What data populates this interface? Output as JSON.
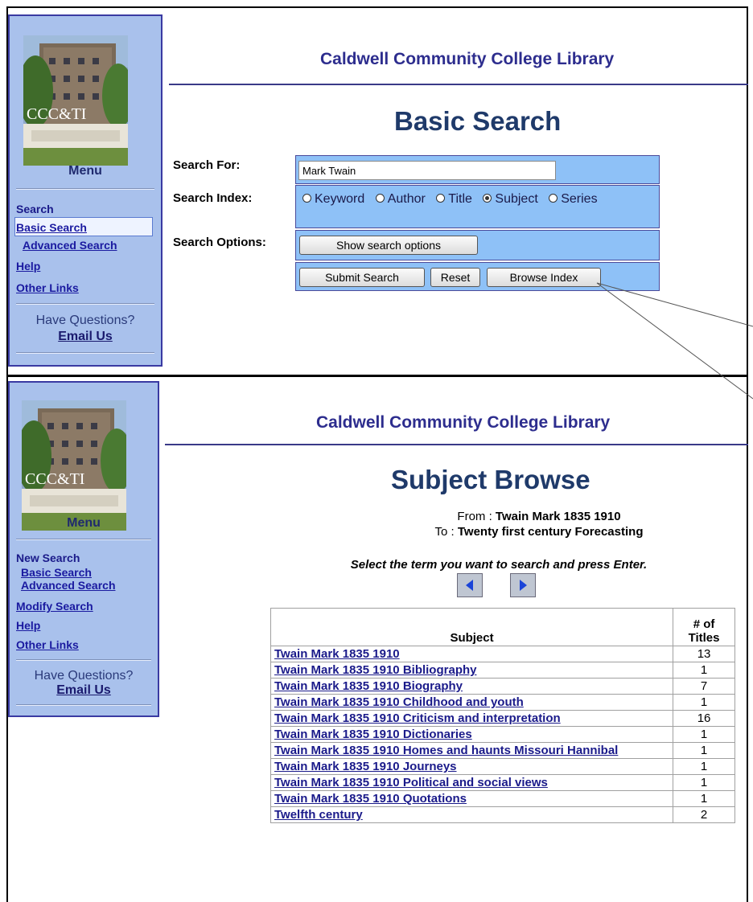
{
  "site_title": "Caldwell Community College Library",
  "sidebar_top": {
    "logo_text": "CCC&TI",
    "menu": "Menu",
    "section": "Search",
    "items": [
      "Basic Search",
      "Advanced Search"
    ],
    "help": "Help",
    "other_links": "Other Links",
    "questions": "Have Questions?",
    "email": "Email Us"
  },
  "basic_search": {
    "title": "Basic Search",
    "search_for_label": "Search For:",
    "search_for_value": "Mark Twain",
    "search_index_label": "Search Index:",
    "index_options": [
      "Keyword",
      "Author",
      "Title",
      "Subject",
      "Series"
    ],
    "selected_index": "Subject",
    "search_options_label": "Search Options:",
    "show_options_button": "Show search options",
    "submit_button": "Submit Search",
    "reset_button": "Reset",
    "browse_button": "Browse Index"
  },
  "sidebar_bottom": {
    "logo_text": "CCC&TI",
    "menu": "Menu",
    "section": "New Search",
    "items": [
      "Basic Search",
      "Advanced Search"
    ],
    "modify": "Modify Search",
    "help": "Help",
    "other_links": "Other Links",
    "questions": "Have Questions?",
    "email": "Email Us"
  },
  "subject_browse": {
    "title": "Subject Browse",
    "from_label": "From :",
    "from_value": "Twain Mark 1835 1910",
    "to_label": "To :",
    "to_value": "Twenty first century Forecasting",
    "instruction": "Select the term you want to search and press Enter.",
    "col_subject": "Subject",
    "col_titles": "# of Titles",
    "rows": [
      {
        "subject": "Twain Mark 1835 1910",
        "count": "13"
      },
      {
        "subject": "Twain Mark 1835 1910 Bibliography",
        "count": "1"
      },
      {
        "subject": "Twain Mark 1835 1910 Biography",
        "count": "7"
      },
      {
        "subject": "Twain Mark 1835 1910 Childhood and youth",
        "count": "1"
      },
      {
        "subject": "Twain Mark 1835 1910 Criticism and interpretation",
        "count": "16"
      },
      {
        "subject": "Twain Mark 1835 1910 Dictionaries",
        "count": "1"
      },
      {
        "subject": "Twain Mark 1835 1910 Homes and haunts Missouri Hannibal",
        "count": "1"
      },
      {
        "subject": "Twain Mark 1835 1910 Journeys",
        "count": "1"
      },
      {
        "subject": "Twain Mark 1835 1910 Political and social views",
        "count": "1"
      },
      {
        "subject": "Twain Mark 1835 1910 Quotations",
        "count": "1"
      },
      {
        "subject": "Twelfth century",
        "count": "2"
      }
    ]
  },
  "colors": {
    "sidebar_bg": "#a9c1ec",
    "form_box": "#8ec1f7",
    "title_blue": "#2d2d8e"
  }
}
